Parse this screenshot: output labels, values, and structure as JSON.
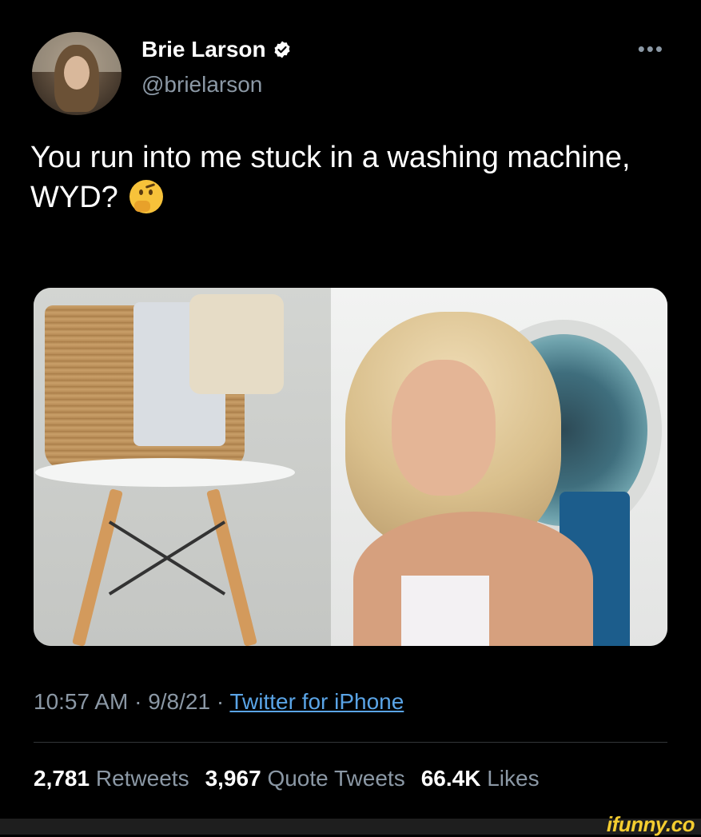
{
  "author": {
    "display_name": "Brie Larson",
    "handle": "@brielarson",
    "verified": true
  },
  "menu_icon": "more-horizontal-icon",
  "tweet": {
    "text": "You run into me stuck in a washing machine, WYD?",
    "emoji": "thinking-face-emoji"
  },
  "meta": {
    "time": "10:57 AM",
    "separator1": " · ",
    "date": "9/8/21",
    "separator2": " · ",
    "source": "Twitter for iPhone"
  },
  "stats": {
    "retweets_count": "2,781",
    "retweets_label": "Retweets",
    "quote_count": "3,967",
    "quote_label": "Quote Tweets",
    "likes_count": "66.4K",
    "likes_label": "Likes"
  },
  "watermark": "ifunny.co",
  "colors": {
    "background": "#000000",
    "primary_text": "#ffffff",
    "secondary_text": "#8b98a5",
    "link": "#5aa4e6",
    "verified_badge": "#ffffff",
    "watermark": "#f4cd30"
  }
}
